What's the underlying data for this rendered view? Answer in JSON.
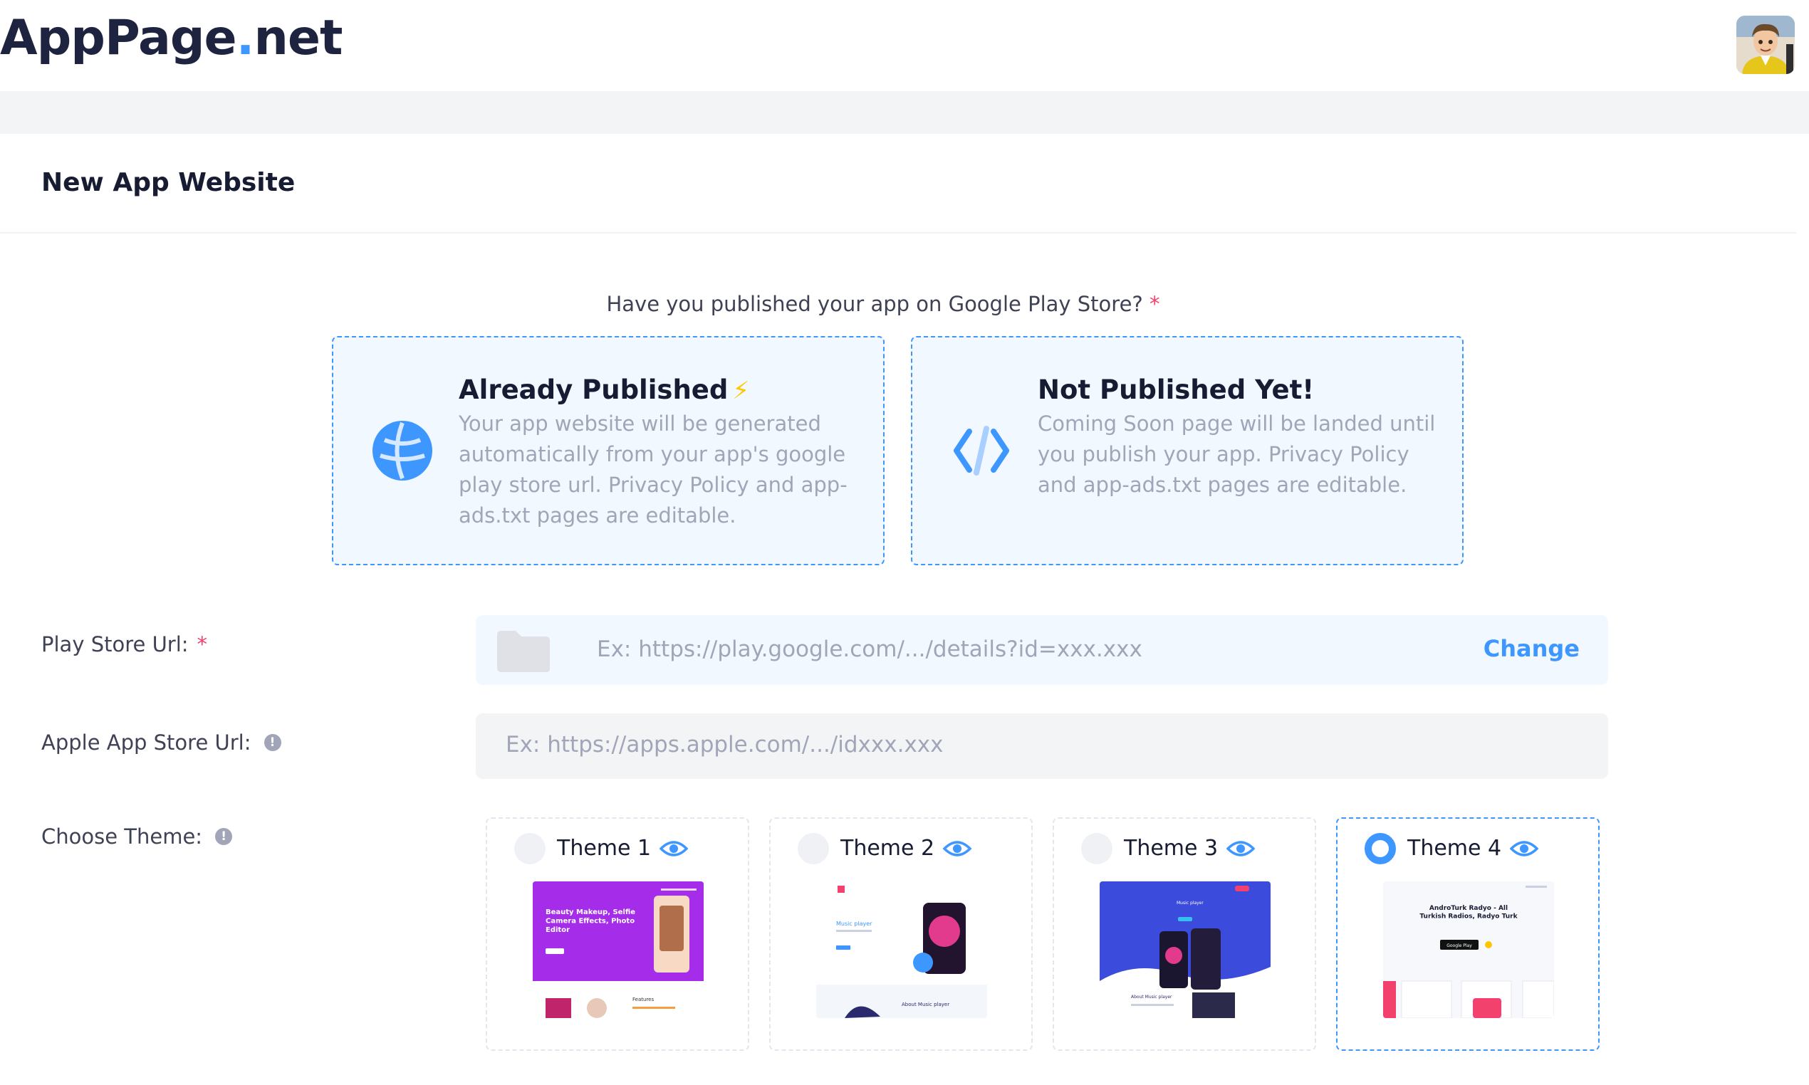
{
  "header": {
    "logo_main": "AppPage",
    "logo_dot": ".",
    "logo_tld": "net"
  },
  "page": {
    "title": "New App Website",
    "question": "Have you published your app on Google Play Store?",
    "required_mark": "*"
  },
  "options": [
    {
      "title": "Already Published",
      "icon": "globe-icon",
      "badge_icon": "bolt-icon",
      "description": "Your app website will be generated automatically from your app's google play store url. Privacy Policy and app-ads.txt pages are editable."
    },
    {
      "title": "Not Published Yet!",
      "icon": "code-icon",
      "description": "Coming Soon page will be landed until you publish your app. Privacy Policy and app-ads.txt pages are editable."
    }
  ],
  "form": {
    "play_store": {
      "label": "Play Store Url:",
      "required_mark": "*",
      "placeholder": "Ex: https://play.google.com/.../details?id=xxx.xxx",
      "action": "Change"
    },
    "apple_store": {
      "label": "Apple App Store Url:",
      "info_icon": "!",
      "placeholder": "Ex: https://apps.apple.com/.../idxxx.xxx"
    },
    "theme": {
      "label": "Choose Theme:",
      "info_icon": "!"
    }
  },
  "themes": [
    {
      "name": "Theme 1",
      "selected": false,
      "preview_text": "Beauty Makeup, Selfie Camera Effects, Photo Editor",
      "preview_footer": "Features",
      "preview_badge": "BEAUTY MAKEUP"
    },
    {
      "name": "Theme 2",
      "selected": false,
      "preview_text": "Music player",
      "preview_footer": "About Music player"
    },
    {
      "name": "Theme 3",
      "selected": false,
      "preview_text": "Music player",
      "preview_footer": "About Music player"
    },
    {
      "name": "Theme 4",
      "selected": true,
      "preview_text": "AndroTurk Radyo - All Turkish Radios, Radyo Turk",
      "preview_badge": "Google Play"
    }
  ],
  "colors": {
    "accent": "#3e97ff",
    "required": "#f1416c",
    "muted_text": "#a1a5b7",
    "option_bg": "#f1f8ff"
  }
}
